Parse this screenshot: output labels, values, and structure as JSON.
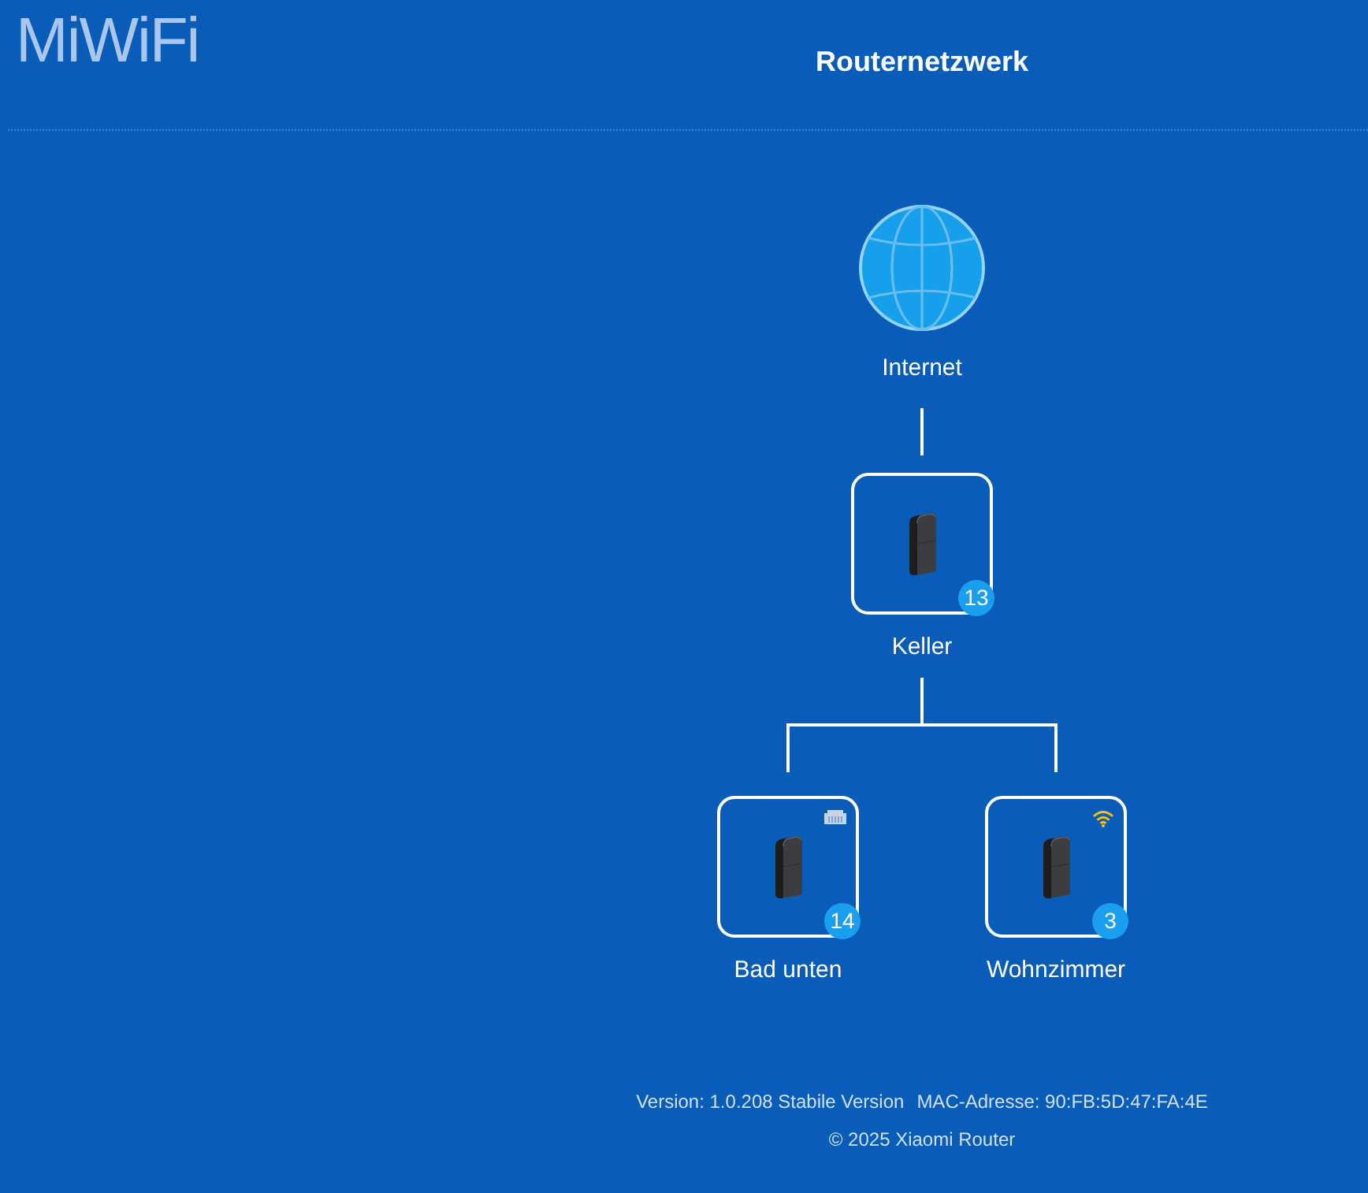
{
  "header": {
    "logo": "MiWiFi",
    "title": "Routernetzwerk"
  },
  "network": {
    "internet": {
      "label": "Internet"
    },
    "root": {
      "name": "Keller",
      "clients": "13",
      "children": [
        {
          "name": "Bad unten",
          "clients": "14",
          "kind": "wired"
        },
        {
          "name": "Wohnzimmer",
          "clients": "3",
          "kind": "wireless"
        }
      ]
    }
  },
  "footer": {
    "version": "Version: 1.0.208 Stabile Version",
    "mac": "MAC-Adresse: 90:FB:5D:47:FA:4E",
    "copyright": "© 2025 Xiaomi Router"
  }
}
